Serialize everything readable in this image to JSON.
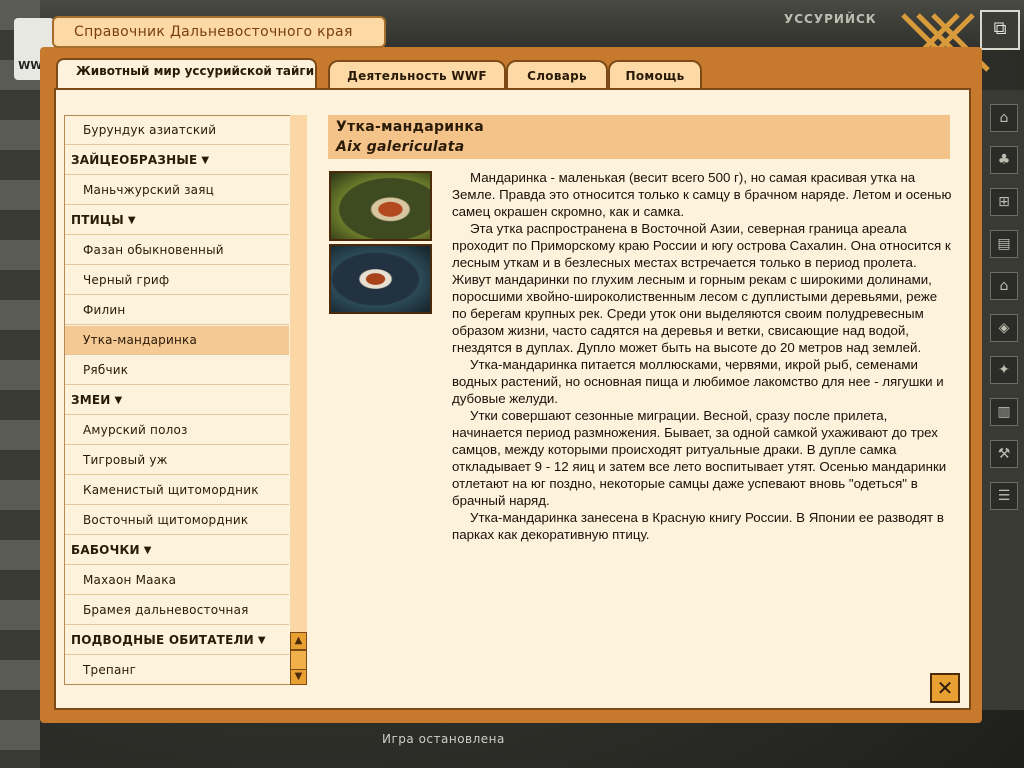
{
  "app": {
    "title": "Справочник Дальневосточного края",
    "location": "УССУРИЙСК",
    "status": "Игра остановлена",
    "logo": "WWF"
  },
  "tabs": [
    {
      "label": "Животный мир уссурийской тайги",
      "active": true
    },
    {
      "label": "Деятельность WWF",
      "active": false
    },
    {
      "label": "Словарь",
      "active": false
    },
    {
      "label": "Помощь",
      "active": false
    }
  ],
  "list": [
    {
      "label": "Бурундук азиатский",
      "type": "item",
      "selected": false
    },
    {
      "label": "ЗАЙЦЕОБРАЗНЫЕ",
      "type": "category",
      "selected": false
    },
    {
      "label": "Маньчжурский заяц",
      "type": "item",
      "selected": false
    },
    {
      "label": "ПТИЦЫ",
      "type": "category",
      "selected": false
    },
    {
      "label": "Фазан обыкновенный",
      "type": "item",
      "selected": false
    },
    {
      "label": "Черный гриф",
      "type": "item",
      "selected": false
    },
    {
      "label": "Филин",
      "type": "item",
      "selected": false
    },
    {
      "label": "Утка-мандаринка",
      "type": "item",
      "selected": true
    },
    {
      "label": "Рябчик",
      "type": "item",
      "selected": false
    },
    {
      "label": "ЗМЕИ",
      "type": "category",
      "selected": false
    },
    {
      "label": "Амурский полоз",
      "type": "item",
      "selected": false
    },
    {
      "label": "Тигровый уж",
      "type": "item",
      "selected": false
    },
    {
      "label": "Каменистый щитомордник",
      "type": "item",
      "selected": false
    },
    {
      "label": "Восточный щитомордник",
      "type": "item",
      "selected": false
    },
    {
      "label": "БАБОЧКИ",
      "type": "category",
      "selected": false
    },
    {
      "label": "Махаон Маака",
      "type": "item",
      "selected": false
    },
    {
      "label": "Брамея дальневосточная",
      "type": "item",
      "selected": false
    },
    {
      "label": "ПОДВОДНЫЕ ОБИТАТЕЛИ",
      "type": "category",
      "selected": false
    },
    {
      "label": "Трепанг",
      "type": "item",
      "selected": false
    }
  ],
  "article": {
    "title": "Утка-мандаринка",
    "latin": "Aix galericulata",
    "paragraphs": [
      "Мандаринка - маленькая (весит всего 500 г), но самая красивая утка на Земле. Правда это относится только к самцу в брачном наряде. Летом и осенью самец окрашен скромно, как и самка.",
      "Эта утка распространена в Восточной Азии, северная граница ареала проходит по Приморскому краю России и югу острова Сахалин. Она относится к лесным уткам и в безлесных местах встречается только в период пролета. Живут мандаринки по глухим лесным и горным рекам с широкими долинами, поросшими хвойно-широколиственным лесом с дуплистыми деревьями, реже по берегам крупных рек. Среди уток они выделяются своим полудревесным образом жизни, часто садятся на деревья и ветки, свисающие над водой, гнездятся в дуплах. Дупло может быть на высоте до 20 метров над землей.",
      "Утка-мандаринка питается моллюсками, червями, икрой рыб, семенами водных растений, но основная пища и любимое лакомство для нее - лягушки и дубовые желуди.",
      "Утки совершают сезонные миграции. Весной, сразу после прилета, начинается период размножения. Бывает, за одной самкой ухаживают до трех самцов, между которыми происходят ритуальные драки. В дупле самка откладывает 9 - 12 яиц и затем все лето воспитывает утят. Осенью мандаринки отлетают на юг поздно, некоторые самцы даже успевают вновь \"одеться\" в брачный наряд.",
      "Утка-мандаринка занесена в Красную книгу России. В Японии ее разводят в парках как декоративную птицу."
    ]
  },
  "icons": {
    "close": "close-icon",
    "dropdown": "triangle-down-icon",
    "scroll_up": "triangle-up-icon",
    "scroll_down": "triangle-down-icon"
  },
  "colors": {
    "window": "#c77a2e",
    "panel": "#fdf2dc",
    "tab": "#fcd9a5",
    "selected": "#f5c994",
    "header": "#f4c38a"
  }
}
